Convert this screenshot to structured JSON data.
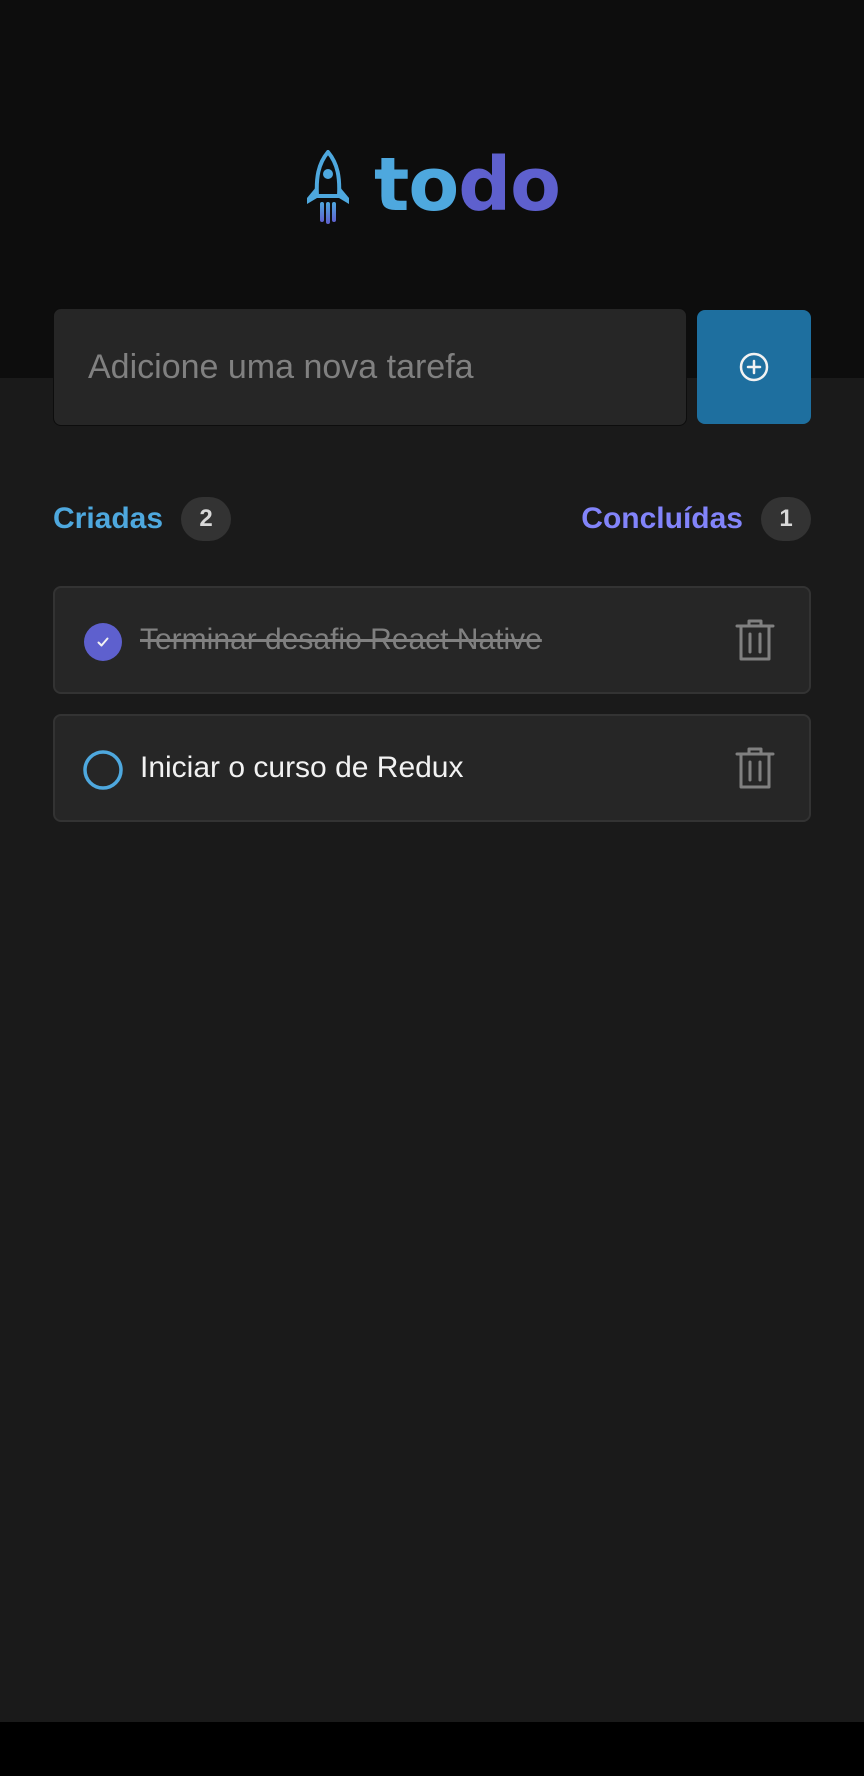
{
  "colors": {
    "blue": "#4ea8de",
    "blue_dark": "#1e6f9f",
    "purple": "#5e60ce",
    "purple_light": "#8284fa",
    "background": "#1a1a1a",
    "header_background": "#0d0d0d"
  },
  "header": {
    "logo_icon": "rocket-icon",
    "logo_part1": "to",
    "logo_part2": "do"
  },
  "new_task": {
    "value": "",
    "placeholder": "Adicione uma nova tarefa",
    "add_icon": "plus-circle-icon"
  },
  "counters": {
    "created_label": "Criadas",
    "created_count": "2",
    "done_label": "Concluídas",
    "done_count": "1"
  },
  "tasks": [
    {
      "title": "Terminar desafio React Native",
      "done": true,
      "delete_icon": "trash-icon"
    },
    {
      "title": "Iniciar o curso de Redux",
      "done": false,
      "delete_icon": "trash-icon"
    }
  ]
}
